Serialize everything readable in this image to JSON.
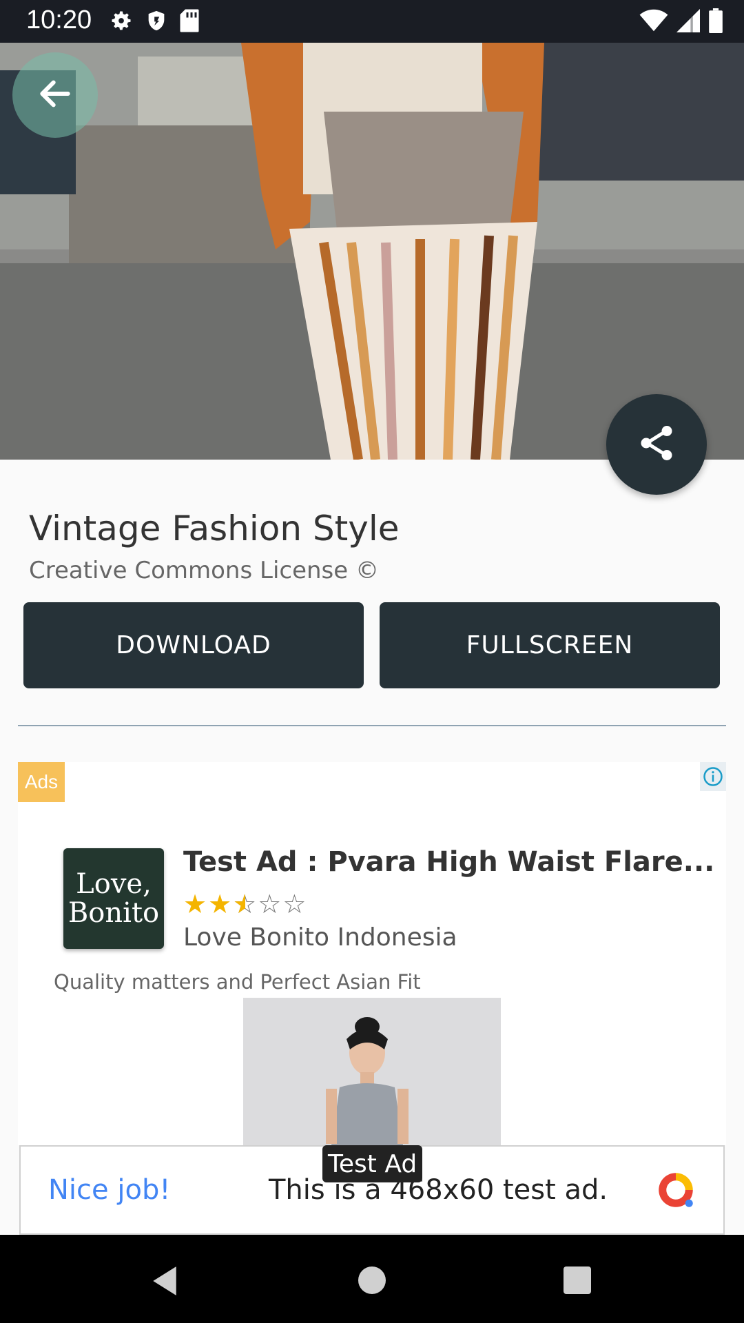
{
  "status_bar": {
    "time": "10:20",
    "left_icons": [
      "gear-icon",
      "shield-icon",
      "sd-card-icon"
    ],
    "right_icons": [
      "wifi-icon",
      "signal-icon",
      "battery-icon"
    ]
  },
  "hero": {
    "image": "photo-of-woman-in-striped-knit-skirt-and-orange-vest-holding-clutch",
    "back_icon": "arrow-left-icon",
    "share_icon": "share-icon"
  },
  "detail": {
    "title": "Vintage Fashion Style",
    "license": "Creative Commons License ©",
    "download_label": "DOWNLOAD",
    "fullscreen_label": "FULLSCREEN"
  },
  "native_ad": {
    "badge": "Ads",
    "info_icon": "info-icon",
    "logo_line1": "Love,",
    "logo_line2": "Bonito",
    "headline": "Test Ad : Pvara High Waist Flare...",
    "rating": 2.5,
    "rating_max": 5,
    "advertiser": "Love Bonito Indonesia",
    "body": "Quality matters and Perfect Asian Fit"
  },
  "banner_ad": {
    "tag": "Test Ad",
    "nice": "Nice job!",
    "text": "This is a 468x60 test ad.",
    "logo_icon": "admob-logo-icon"
  },
  "nav_bar": {
    "icons": [
      "back-triangle-icon",
      "home-circle-icon",
      "recents-square-icon"
    ]
  },
  "colors": {
    "primary_dark": "#263238",
    "ads_badge": "#f7c15a",
    "star": "#f4b400",
    "nice_blue": "#4285f4"
  }
}
